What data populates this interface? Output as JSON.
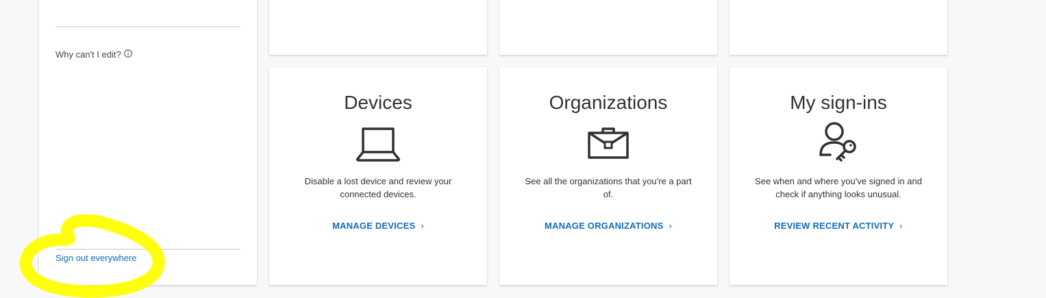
{
  "sidebar": {
    "why_edit_label": "Why can't I edit?",
    "signout_label": "Sign out everywhere"
  },
  "cards": [
    {
      "title": "Devices",
      "icon": "laptop-icon",
      "description": "Disable a lost device and review your connected devices.",
      "link_label": "MANAGE DEVICES"
    },
    {
      "title": "Organizations",
      "icon": "briefcase-icon",
      "description": "See all the organizations that you're a part of.",
      "link_label": "MANAGE ORGANIZATIONS"
    },
    {
      "title": "My sign-ins",
      "icon": "user-key-icon",
      "description": "See when and where you've signed in and check if anything looks unusual.",
      "link_label": "REVIEW RECENT ACTIVITY"
    }
  ],
  "colors": {
    "link": "#0f6cbd",
    "highlight": "#ffff00",
    "background": "#f8f8f8"
  }
}
